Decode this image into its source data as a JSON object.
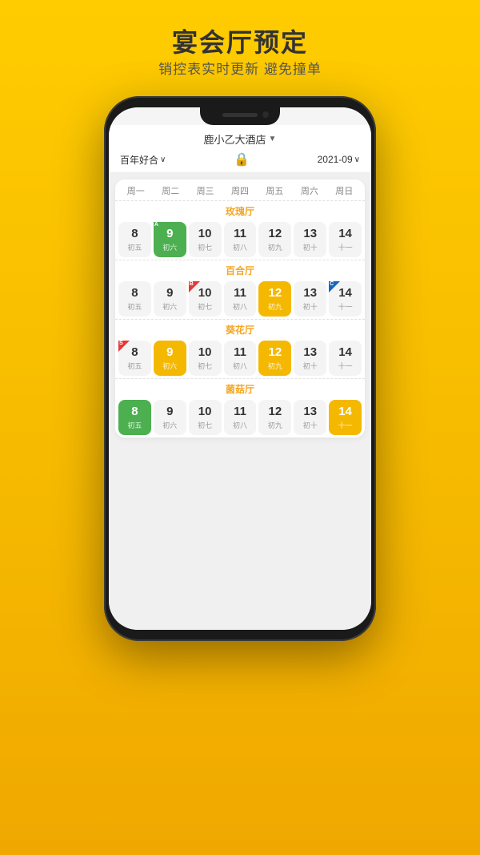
{
  "page": {
    "title": "宴会厅预定",
    "subtitle": "销控表实时更新  避免撞单"
  },
  "header": {
    "hotel_name": "鹿小乙大酒店",
    "filter_left": "百年好合",
    "date": "2021-09"
  },
  "weekdays": [
    "周一",
    "周二",
    "周三",
    "周四",
    "周五",
    "周六",
    "周日"
  ],
  "halls": [
    {
      "name": "玫瑰厅",
      "cells": [
        {
          "date": "8",
          "lunar": "初五",
          "type": "white",
          "badge": null
        },
        {
          "date": "9",
          "lunar": "初六",
          "type": "green",
          "badge": "A"
        },
        {
          "date": "10",
          "lunar": "初七",
          "type": "white",
          "badge": null
        },
        {
          "date": "11",
          "lunar": "初八",
          "type": "white",
          "badge": null
        },
        {
          "date": "12",
          "lunar": "初九",
          "type": "white",
          "badge": null
        },
        {
          "date": "13",
          "lunar": "初十",
          "type": "white",
          "badge": null
        },
        {
          "date": "14",
          "lunar": "十一",
          "type": "white",
          "badge": null
        }
      ]
    },
    {
      "name": "百合厅",
      "cells": [
        {
          "date": "8",
          "lunar": "初五",
          "type": "white",
          "badge": null
        },
        {
          "date": "9",
          "lunar": "初六",
          "type": "white",
          "badge": null
        },
        {
          "date": "10",
          "lunar": "初七",
          "type": "white",
          "badge": "B"
        },
        {
          "date": "11",
          "lunar": "初八",
          "type": "white",
          "badge": null
        },
        {
          "date": "12",
          "lunar": "初九",
          "type": "yellow",
          "badge": null
        },
        {
          "date": "13",
          "lunar": "初十",
          "type": "white",
          "badge": null
        },
        {
          "date": "14",
          "lunar": "十一",
          "type": "white",
          "badge": "C"
        }
      ]
    },
    {
      "name": "葵花厅",
      "cells": [
        {
          "date": "8",
          "lunar": "初五",
          "type": "white",
          "badge": "S"
        },
        {
          "date": "9",
          "lunar": "初六",
          "type": "yellow",
          "badge": null
        },
        {
          "date": "10",
          "lunar": "初七",
          "type": "white",
          "badge": null
        },
        {
          "date": "11",
          "lunar": "初八",
          "type": "white",
          "badge": null
        },
        {
          "date": "12",
          "lunar": "初九",
          "type": "yellow",
          "badge": null
        },
        {
          "date": "13",
          "lunar": "初十",
          "type": "white",
          "badge": null
        },
        {
          "date": "14",
          "lunar": "十一",
          "type": "white",
          "badge": null
        }
      ]
    },
    {
      "name": "菌菇厅",
      "cells": [
        {
          "date": "8",
          "lunar": "初五",
          "type": "green",
          "badge": null
        },
        {
          "date": "9",
          "lunar": "初六",
          "type": "white",
          "badge": null
        },
        {
          "date": "10",
          "lunar": "初七",
          "type": "white",
          "badge": null
        },
        {
          "date": "11",
          "lunar": "初八",
          "type": "white",
          "badge": null
        },
        {
          "date": "12",
          "lunar": "初九",
          "type": "white",
          "badge": null
        },
        {
          "date": "13",
          "lunar": "初十",
          "type": "white",
          "badge": null
        },
        {
          "date": "14",
          "lunar": "十一",
          "type": "yellow",
          "badge": null
        }
      ]
    }
  ]
}
